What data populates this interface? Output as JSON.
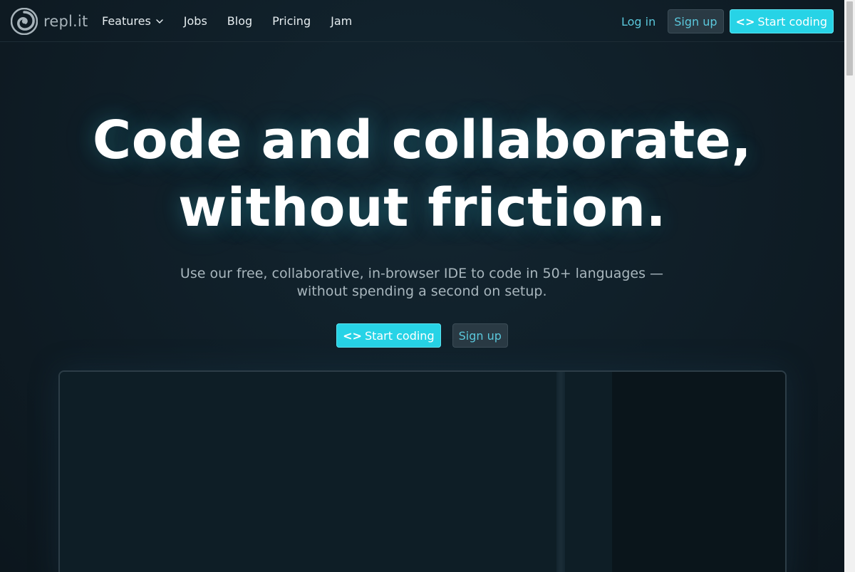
{
  "brand": {
    "logo_text": "repl.it",
    "accent_color": "#27d3e6",
    "link_color": "#5bc8dc",
    "background_color": "#0e1a22"
  },
  "nav": {
    "items": [
      {
        "label": "Features",
        "has_dropdown": true
      },
      {
        "label": "Jobs"
      },
      {
        "label": "Blog"
      },
      {
        "label": "Pricing"
      },
      {
        "label": "Jam"
      }
    ],
    "login_label": "Log in",
    "signup_label": "Sign up",
    "start_label": "Start coding",
    "start_icon": "code-brackets-icon"
  },
  "hero": {
    "title_line1": "Code and collaborate,",
    "title_line2": "without friction.",
    "subtitle": "Use our free, collaborative, in-browser IDE to code in 50+ languages — without spending a second on setup.",
    "primary_cta": "Start coding",
    "secondary_cta": "Sign up"
  }
}
